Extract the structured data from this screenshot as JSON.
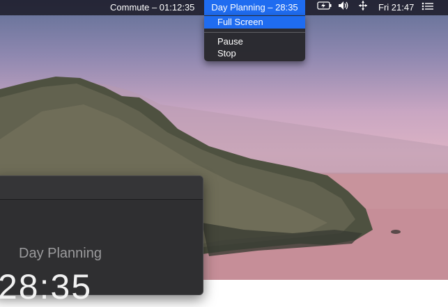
{
  "menubar": {
    "commute_timer": "Commute – 01:12:35",
    "active_timer": "Day Planning – 28:35",
    "clock": "Fri 21:47",
    "icons": [
      "battery-charging-icon",
      "volume-icon",
      "move-arrows-icon",
      "list-icon"
    ]
  },
  "dropdown": {
    "items": [
      {
        "label": "Full Screen",
        "selected": true
      },
      {
        "label": "Pause",
        "selected": false
      },
      {
        "label": "Stop",
        "selected": false
      }
    ]
  },
  "app_window": {
    "title": "Day Planning",
    "time": "28:35"
  },
  "colors": {
    "accent": "#1f6cf0",
    "menubar": "#14121c",
    "window": "#2f2f31"
  }
}
